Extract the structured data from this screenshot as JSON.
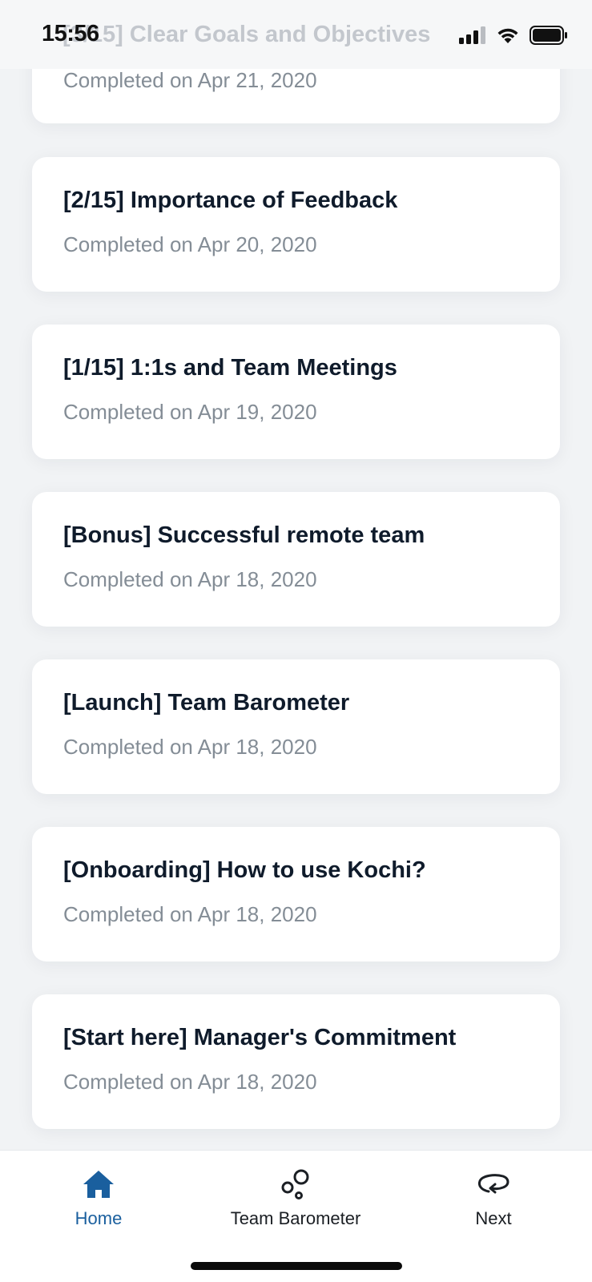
{
  "status_bar": {
    "time": "15:56"
  },
  "header": {
    "ghost_title": "[3/15] Clear Goals and Objectives"
  },
  "lessons": [
    {
      "title": "",
      "subtitle": "Completed on Apr 21, 2020"
    },
    {
      "title": "[2/15] Importance of Feedback",
      "subtitle": "Completed on Apr 20, 2020"
    },
    {
      "title": "[1/15] 1:1s and Team Meetings",
      "subtitle": "Completed on Apr 19, 2020"
    },
    {
      "title": "[Bonus] Successful remote team",
      "subtitle": "Completed on Apr 18, 2020"
    },
    {
      "title": "[Launch] Team Barometer",
      "subtitle": "Completed on Apr 18, 2020"
    },
    {
      "title": "[Onboarding] How to use Kochi?",
      "subtitle": "Completed on Apr 18, 2020"
    },
    {
      "title": "[Start here] Manager's Commitment",
      "subtitle": "Completed on Apr 18, 2020"
    }
  ],
  "tabs": [
    {
      "label": "Home",
      "icon": "home-icon",
      "active": true
    },
    {
      "label": "Team Barometer",
      "icon": "barometer-icon",
      "active": false
    },
    {
      "label": "Next",
      "icon": "next-icon",
      "active": false
    }
  ],
  "colors": {
    "accent": "#1a5f9e",
    "title": "#0f1b2b",
    "subtitle": "#848d96",
    "background": "#f1f3f5"
  }
}
